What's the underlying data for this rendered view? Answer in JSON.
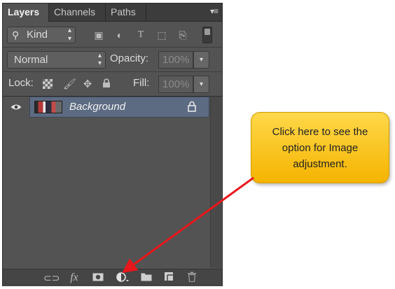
{
  "panel": {
    "tabs": [
      {
        "label": "Layers",
        "active": true
      },
      {
        "label": "Channels",
        "active": false
      },
      {
        "label": "Paths",
        "active": false
      }
    ],
    "menu_icon": "panel-menu-icon"
  },
  "filter": {
    "kind_label": "Kind",
    "icons": [
      "pixel-filter-icon",
      "adjustment-filter-icon",
      "type-filter-icon",
      "shape-filter-icon",
      "smart-object-filter-icon"
    ]
  },
  "blend": {
    "mode": "Normal",
    "opacity_label": "Opacity:",
    "opacity_value": "100%"
  },
  "lock": {
    "label": "Lock:",
    "fill_label": "Fill:",
    "fill_value": "100%"
  },
  "layers": [
    {
      "name": "Background",
      "visible": true,
      "locked": true,
      "selected": true
    }
  ],
  "bottom_toolbar": {
    "icons": [
      "link-layers-icon",
      "fx-icon",
      "layer-mask-icon",
      "adjustment-layer-icon",
      "new-group-icon",
      "new-layer-icon",
      "trash-icon"
    ],
    "fx_text": "fx"
  },
  "callout": {
    "text": "Click here to see the option for Image adjustment.",
    "color": "#f9c31b",
    "arrow_color": "#e8171b"
  }
}
